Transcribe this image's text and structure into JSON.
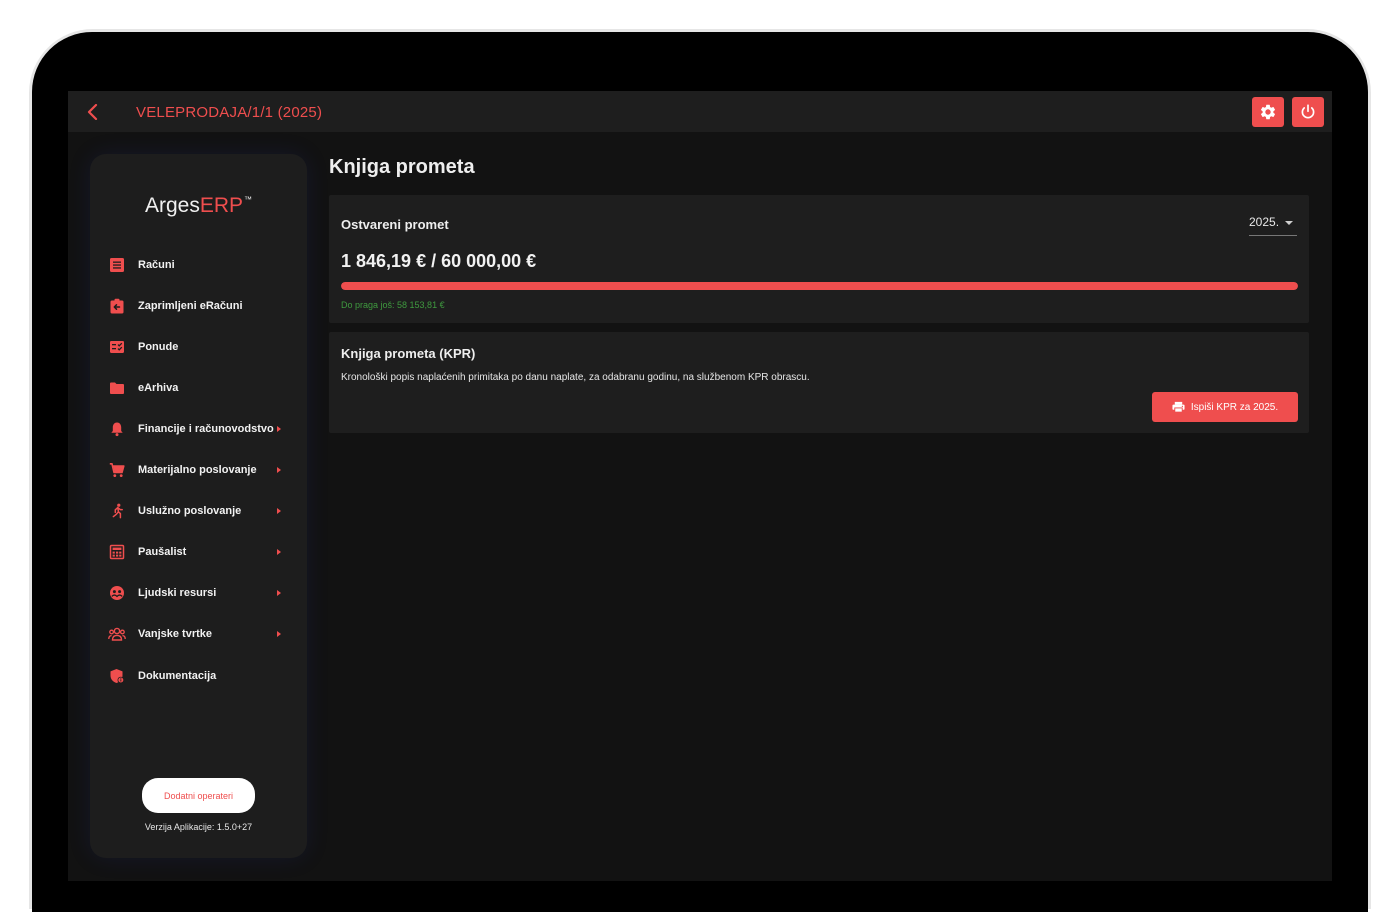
{
  "topbar": {
    "title": "VELEPRODAJA/1/1 (2025)",
    "back_icon": "chevron-left-icon",
    "settings_icon": "gear-icon",
    "power_icon": "power-icon"
  },
  "sidebar": {
    "logo": {
      "part1": "Arges",
      "part2": "ERP",
      "mark": "™"
    },
    "items": [
      {
        "label": "Računi",
        "icon": "receipt-icon",
        "has_submenu": false
      },
      {
        "label": "Zaprimljeni eRačuni",
        "icon": "clipboard-in-icon",
        "has_submenu": false
      },
      {
        "label": "Ponude",
        "icon": "checklist-icon",
        "has_submenu": false
      },
      {
        "label": "eArhiva",
        "icon": "folder-icon",
        "has_submenu": false
      },
      {
        "label": "Financije i računovodstvo",
        "icon": "bell-icon",
        "has_submenu": true
      },
      {
        "label": "Materijalno poslovanje",
        "icon": "cart-icon",
        "has_submenu": true
      },
      {
        "label": "Uslužno poslovanje",
        "icon": "runner-icon",
        "has_submenu": true
      },
      {
        "label": "Paušalist",
        "icon": "calculator-icon",
        "has_submenu": true
      },
      {
        "label": "Ljudski resursi",
        "icon": "people-circle-icon",
        "has_submenu": true
      },
      {
        "label": "Vanjske tvrtke",
        "icon": "group-icon",
        "has_submenu": true
      },
      {
        "label": "Dokumentacija",
        "icon": "shield-info-icon",
        "has_submenu": false
      }
    ],
    "operators_button": "Dodatni operateri",
    "version": "Verzija Aplikacije: 1.5.0+27"
  },
  "main": {
    "title": "Knjiga prometa",
    "turnover": {
      "title": "Ostvareni promet",
      "year": "2025.",
      "amount": "1 846,19 € / 60 000,00 €",
      "progress_fraction": 1.0,
      "remaining": "Do praga još: 58 153,81 €"
    },
    "kpr": {
      "title": "Knjiga prometa (KPR)",
      "description": "Kronološki popis naplaćenih primitaka po danu naplate, za odabranu godinu, na službenom KPR obrascu.",
      "print_label": "Ispiši KPR za 2025.",
      "print_icon": "printer-icon"
    }
  },
  "colors": {
    "accent": "#ef4e4e",
    "success": "#3f9a3f",
    "background": "#121212",
    "surface": "#1e1e1e"
  }
}
